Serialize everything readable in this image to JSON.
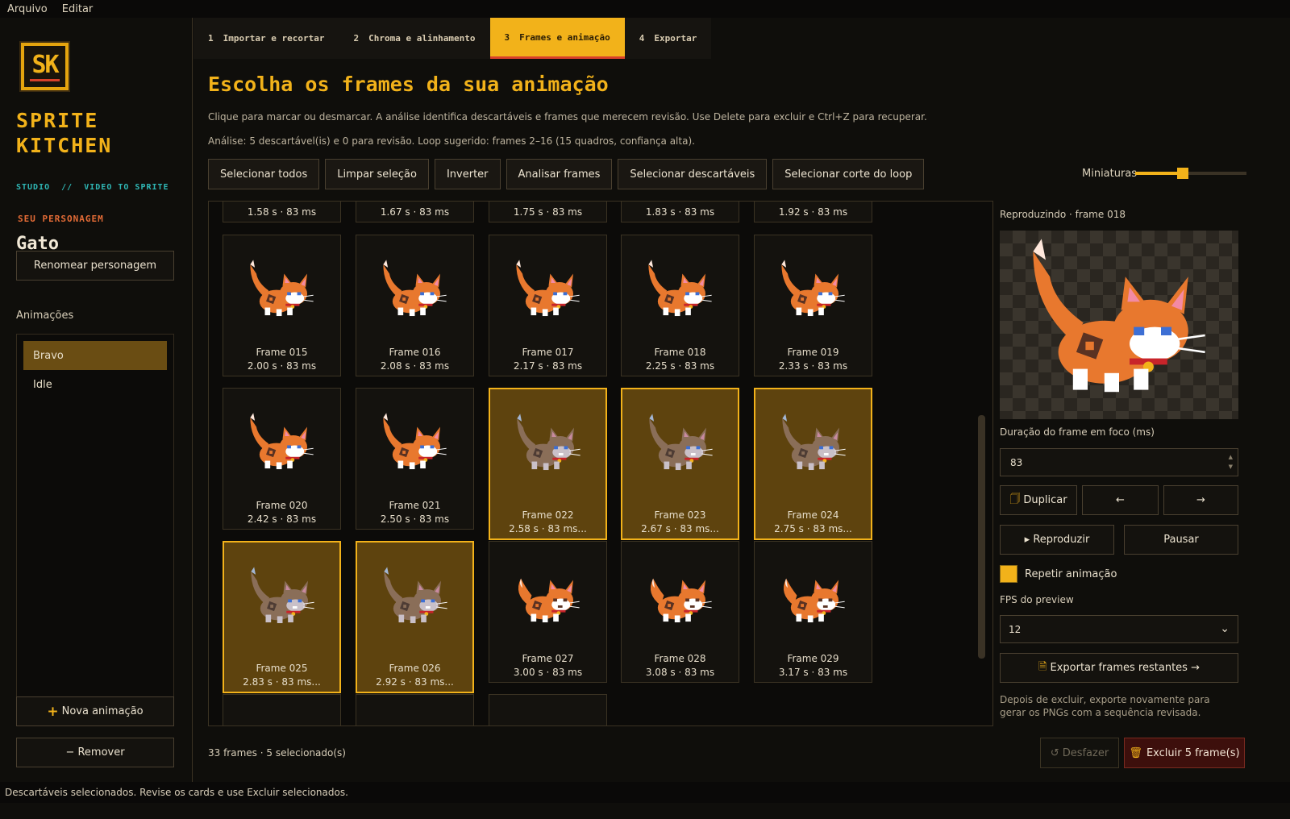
{
  "menu": [
    "Arquivo",
    "Editar"
  ],
  "brand": {
    "logo_text": "SK",
    "name_line1": "SPRITE",
    "name_line2": "KITCHEN",
    "subtitle": "STUDIO  //  VIDEO TO SPRITE"
  },
  "character": {
    "label": "SEU PERSONAGEM",
    "name": "Gato",
    "rename_button": "Renomear personagem"
  },
  "animations": {
    "label": "Animações",
    "items": [
      {
        "label": "Bravo",
        "active": true
      },
      {
        "label": "Idle",
        "active": false
      }
    ],
    "new_button": "Nova animação",
    "remove_button": "− Remover"
  },
  "tabs": [
    {
      "num": "1",
      "label": "Importar e recortar"
    },
    {
      "num": "2",
      "label": "Chroma e alinhamento"
    },
    {
      "num": "3",
      "label": "Frames e animação"
    },
    {
      "num": "4",
      "label": "Exportar"
    }
  ],
  "main": {
    "title": "Escolha os frames da sua animação",
    "description": "Clique para marcar ou desmarcar. A análise identifica descartáveis e frames que merecem revisão. Use Delete para excluir e Ctrl+Z para recuperar.",
    "analysis": "Análise: 5 descartável(is) e 0 para revisão. Loop sugerido: frames 2–16 (15 quadros, confiança alta).",
    "toolbar": [
      "Selecionar todos",
      "Limpar seleção",
      "Inverter",
      "Analisar frames",
      "Selecionar descartáveis",
      "Selecionar corte do loop"
    ],
    "thumb_label": "Miniaturas",
    "thumb_value": 0.42
  },
  "frames_top_partial": [
    "1.58 s · 83 ms",
    "1.67 s · 83 ms",
    "1.75 s · 83 ms",
    "1.83 s · 83 ms",
    "1.92 s · 83 ms"
  ],
  "frames": [
    {
      "name": "Frame 015",
      "time": "2.00 s · 83 ms",
      "selected": false,
      "variant": "angry"
    },
    {
      "name": "Frame 016",
      "time": "2.08 s · 83 ms",
      "selected": false,
      "variant": "angry"
    },
    {
      "name": "Frame 017",
      "time": "2.17 s · 83 ms",
      "selected": false,
      "variant": "angry"
    },
    {
      "name": "Frame 018",
      "time": "2.25 s · 83 ms",
      "selected": false,
      "variant": "angry"
    },
    {
      "name": "Frame 019",
      "time": "2.33 s · 83 ms",
      "selected": false,
      "variant": "angry"
    },
    {
      "name": "Frame 020",
      "time": "2.42 s · 83 ms",
      "selected": false,
      "variant": "angry"
    },
    {
      "name": "Frame 021",
      "time": "2.50 s · 83 ms",
      "selected": false,
      "variant": "angry"
    },
    {
      "name": "Frame 022",
      "time": "2.58 s · 83 ms...",
      "selected": true,
      "variant": "angry"
    },
    {
      "name": "Frame 023",
      "time": "2.67 s · 83 ms...",
      "selected": true,
      "variant": "angry"
    },
    {
      "name": "Frame 024",
      "time": "2.75 s · 83 ms...",
      "selected": true,
      "variant": "angry"
    },
    {
      "name": "Frame 025",
      "time": "2.83 s · 83 ms...",
      "selected": true,
      "variant": "angry"
    },
    {
      "name": "Frame 026",
      "time": "2.92 s · 83 ms...",
      "selected": true,
      "variant": "angry"
    },
    {
      "name": "Frame 027",
      "time": "3.00 s · 83 ms",
      "selected": false,
      "variant": "calm"
    },
    {
      "name": "Frame 028",
      "time": "3.08 s · 83 ms",
      "selected": false,
      "variant": "calm"
    },
    {
      "name": "Frame 029",
      "time": "3.17 s · 83 ms",
      "selected": false,
      "variant": "calm"
    }
  ],
  "preview": {
    "playing": "Reproduzindo · frame 018",
    "duration_label": "Duração do frame em foco (ms)",
    "duration_value": "83",
    "duplicate": "Duplicar",
    "prev": "←",
    "next": "→",
    "play": "▸ Reproduzir",
    "pause": "Pausar",
    "repeat_label": "Repetir animação",
    "repeat_checked": true,
    "fps_label": "FPS do preview",
    "fps_value": "12",
    "export_button": "Exportar frames restantes →",
    "export_note": "Depois de excluir, exporte novamente para gerar os PNGs com a sequência revisada."
  },
  "footer": {
    "count": "33 frames · 5 selecionado(s)",
    "undo": "Desfazer",
    "delete": "Excluir 5 frame(s)"
  },
  "status": "Descartáveis selecionados. Revise os cards e use Excluir selecionados.",
  "colors": {
    "accent": "#f2b21a",
    "danger": "#d8412a",
    "teal": "#2fb7b5",
    "cat_orange": "#e8782e",
    "cat_muted": "#8a6e58"
  }
}
